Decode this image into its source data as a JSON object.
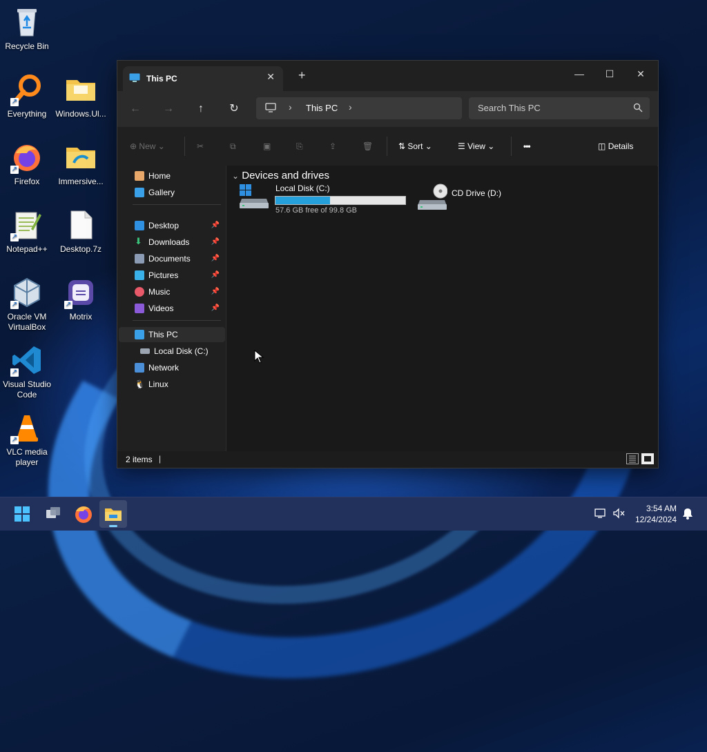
{
  "desktop": {
    "icons": [
      {
        "label": "Recycle Bin",
        "icon": "recycle-bin-icon"
      },
      {
        "label": "Everything",
        "icon": "everything-icon"
      },
      {
        "label": "Windows.Ul...",
        "icon": "folder-icon"
      },
      {
        "label": "Firefox",
        "icon": "firefox-icon"
      },
      {
        "label": "Immersive...",
        "icon": "folder-icon"
      },
      {
        "label": "Notepad++",
        "icon": "notepadpp-icon"
      },
      {
        "label": "Desktop.7z",
        "icon": "file-icon"
      },
      {
        "label": "Oracle VM VirtualBox",
        "icon": "virtualbox-icon"
      },
      {
        "label": "Motrix",
        "icon": "motrix-icon"
      },
      {
        "label": "Visual Studio Code",
        "icon": "vscode-icon"
      },
      {
        "label": "VLC media player",
        "icon": "vlc-icon"
      }
    ]
  },
  "explorer": {
    "tab_title": "This PC",
    "new_tab_label": "+",
    "window_controls": {
      "minimize": "—",
      "maximize": "☐",
      "close": "✕"
    },
    "address": {
      "crumbs": [
        "This PC"
      ]
    },
    "search_placeholder": "Search This PC",
    "commands": {
      "new": "New",
      "sort": "Sort",
      "view": "View",
      "more": "•••",
      "details": "Details"
    },
    "sidebar": {
      "items": [
        {
          "label": "Home",
          "icon": "home-icon",
          "pinned": false
        },
        {
          "label": "Gallery",
          "icon": "gallery-icon",
          "pinned": false
        },
        {
          "label": "Desktop",
          "icon": "desktop-icon",
          "pinned": true
        },
        {
          "label": "Downloads",
          "icon": "downloads-icon",
          "pinned": true
        },
        {
          "label": "Documents",
          "icon": "documents-icon",
          "pinned": true
        },
        {
          "label": "Pictures",
          "icon": "pictures-icon",
          "pinned": true
        },
        {
          "label": "Music",
          "icon": "music-icon",
          "pinned": true
        },
        {
          "label": "Videos",
          "icon": "videos-icon",
          "pinned": true
        },
        {
          "label": "This PC",
          "icon": "this-pc-icon",
          "pinned": false,
          "selected": true
        },
        {
          "label": "Local Disk (C:)",
          "icon": "drive-icon",
          "pinned": false
        },
        {
          "label": "Network",
          "icon": "network-icon",
          "pinned": false
        },
        {
          "label": "Linux",
          "icon": "linux-icon",
          "pinned": false
        }
      ]
    },
    "group": {
      "title": "Devices and drives"
    },
    "drives": [
      {
        "name": "Local Disk (C:)",
        "free_text": "57.6 GB free of 99.8 GB",
        "used_fraction": 0.42
      },
      {
        "name": "CD Drive (D:)"
      }
    ],
    "status": {
      "items": "2 items"
    },
    "accent": "#26a0da"
  },
  "taskbar": {
    "time": "3:54 AM",
    "date": "12/24/2024"
  }
}
